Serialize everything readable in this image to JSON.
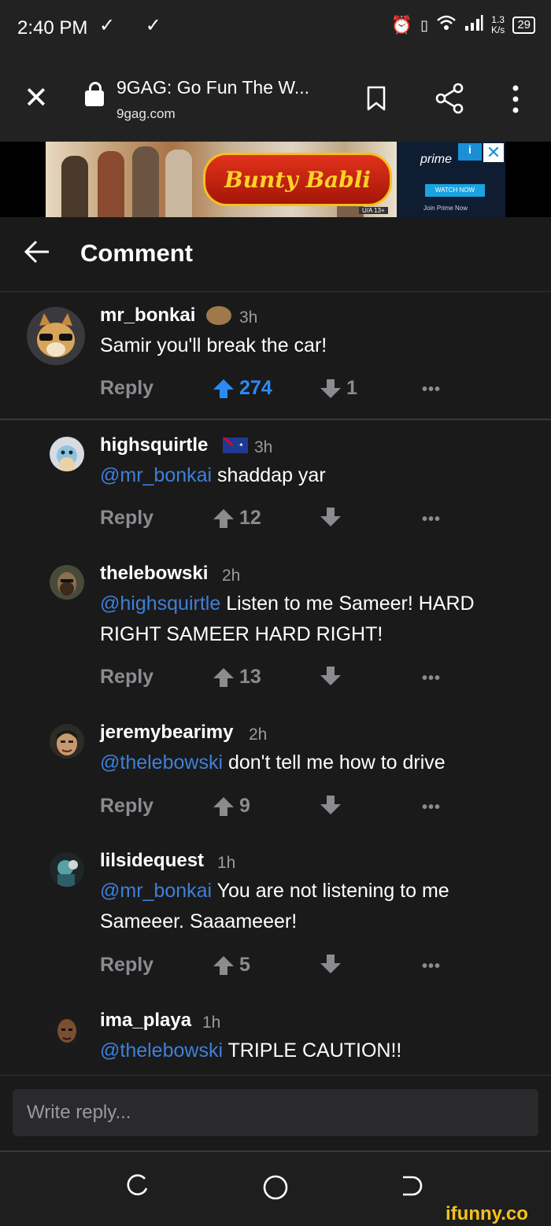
{
  "status_bar": {
    "time": "2:40 PM",
    "notif_icons": "✓ ✓",
    "speed_value": "1.3",
    "speed_unit": "K/s",
    "battery": "29"
  },
  "browser": {
    "page_title": "9GAG: Go Fun The W...",
    "domain": "9gag.com"
  },
  "ad": {
    "logo_text": "Bunty Babli",
    "rating": "U/A 13+",
    "prime_text": "prime",
    "watch_label": "WATCH NOW",
    "join_text": "Join Prime Now",
    "info_label": "i",
    "close_label": "✕"
  },
  "header": {
    "title": "Comment"
  },
  "actions": {
    "reply_label": "Reply",
    "more_label": "•••"
  },
  "comments": [
    {
      "username": "mr_bonkai",
      "time": "3h",
      "mention": "",
      "text": "Samir you'll break the car!",
      "upvotes": "274",
      "downvotes": "1",
      "upvoted": true
    },
    {
      "username": "highsquirtle",
      "time": "3h",
      "mention": "@mr_bonkai",
      "text": " shaddap yar",
      "upvotes": "12",
      "downvotes": ""
    },
    {
      "username": "thelebowski",
      "time": "2h",
      "mention": "@highsquirtle",
      "text": " Listen to me Sameer! HARD RIGHT SAMEER HARD RIGHT!",
      "upvotes": "13",
      "downvotes": ""
    },
    {
      "username": "jeremybearimy",
      "time": "2h",
      "mention": "@thelebowski",
      "text": " don't tell me how to drive",
      "upvotes": "9",
      "downvotes": ""
    },
    {
      "username": "lilsidequest",
      "time": "1h",
      "mention": "@mr_bonkai",
      "text": " You are not listening to me Sameeer. Saaameeer!",
      "upvotes": "5",
      "downvotes": ""
    },
    {
      "username": "ima_playa",
      "time": "1h",
      "mention": "@thelebowski",
      "text": " TRIPLE CAUTION!!"
    }
  ],
  "reply_box": {
    "placeholder": "Write reply..."
  },
  "watermark": "ifunny.co",
  "colors": {
    "background": "#1a1a1b",
    "mention": "#3f7fd8",
    "upvote_active": "#2a8bf5",
    "muted": "#8b8b90",
    "watermark": "#f7c21b"
  }
}
